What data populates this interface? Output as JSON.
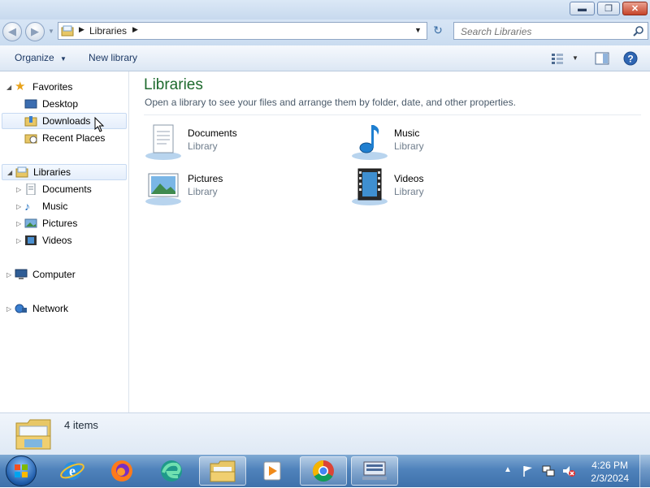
{
  "window": {
    "minimize_glyph": "▬",
    "restore_glyph": "❐",
    "close_glyph": "✕"
  },
  "address": {
    "crumb": "Libraries",
    "refresh_glyph": "↻"
  },
  "search": {
    "placeholder": "Search Libraries"
  },
  "toolbar": {
    "organize": "Organize",
    "new_library": "New library"
  },
  "nav": {
    "favorites": "Favorites",
    "desktop": "Desktop",
    "downloads": "Downloads",
    "recent": "Recent Places",
    "libraries": "Libraries",
    "documents": "Documents",
    "music": "Music",
    "pictures": "Pictures",
    "videos": "Videos",
    "computer": "Computer",
    "network": "Network"
  },
  "main": {
    "title": "Libraries",
    "subtitle": "Open a library to see your files and arrange them by folder, date, and other properties.",
    "items": [
      {
        "name": "Documents",
        "type": "Library"
      },
      {
        "name": "Music",
        "type": "Library"
      },
      {
        "name": "Pictures",
        "type": "Library"
      },
      {
        "name": "Videos",
        "type": "Library"
      }
    ]
  },
  "details": {
    "count": "4 items"
  },
  "taskbar": {
    "time": "4:26 PM",
    "date": "2/3/2024"
  },
  "colors": {
    "title_green": "#1e6a2e",
    "taskbar_blue": "#4f82bb"
  }
}
